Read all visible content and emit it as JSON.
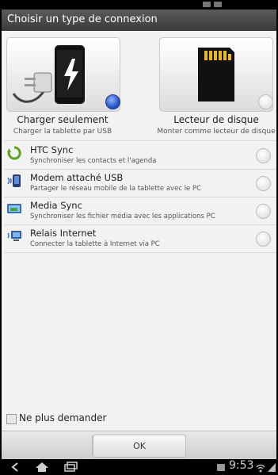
{
  "dialog": {
    "title": "Choisir un type de connexion",
    "options_large": [
      {
        "label": "Charger seulement",
        "sub": "Charger la tablette par USB",
        "selected": true,
        "icon": "charger-icon"
      },
      {
        "label": "Lecteur de disque",
        "sub": "Monter comme lecteur de disque",
        "selected": false,
        "icon": "sd-card-icon"
      }
    ],
    "options_list": [
      {
        "title": "HTC Sync",
        "sub": "Synchroniser les contacts et l'agenda",
        "icon": "htc-sync-icon",
        "selected": false
      },
      {
        "title": "Modem attaché USB",
        "sub": "Partager le réseau mobile de la tablette avec le PC",
        "icon": "usb-modem-icon",
        "selected": false
      },
      {
        "title": "Media Sync",
        "sub": "Synchroniser les fichier média avec les applications PC",
        "icon": "media-sync-icon",
        "selected": false
      },
      {
        "title": "Relais Internet",
        "sub": "Connecter la tablette à Internet via PC",
        "icon": "internet-relay-icon",
        "selected": false
      }
    ],
    "dont_ask": {
      "label": "Ne plus demander",
      "checked": false
    },
    "ok_label": "OK"
  },
  "system": {
    "time": "9:53"
  },
  "colors": {
    "accent_selected": "#2a56c8",
    "title_bar": "#4a4a4a",
    "dialog_bg": "#f2f2f2"
  }
}
